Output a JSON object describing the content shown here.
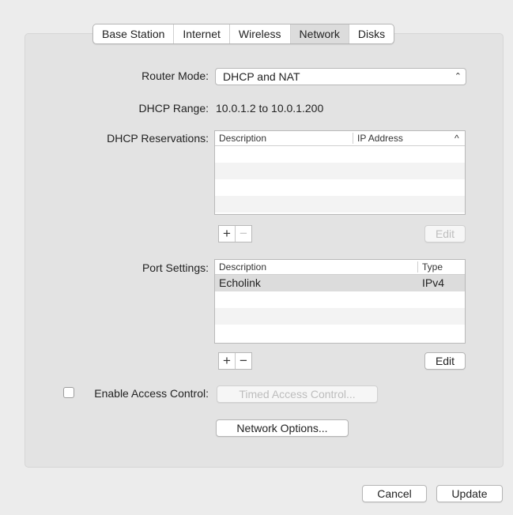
{
  "tabs": [
    {
      "label": "Base Station",
      "active": false
    },
    {
      "label": "Internet",
      "active": false
    },
    {
      "label": "Wireless",
      "active": false
    },
    {
      "label": "Network",
      "active": true
    },
    {
      "label": "Disks",
      "active": false
    }
  ],
  "router_mode": {
    "label": "Router Mode:",
    "value": "DHCP and NAT",
    "icon": "updown-chevrons-icon"
  },
  "dhcp_range": {
    "label": "DHCP Range:",
    "value": "10.0.1.2 to 10.0.1.200"
  },
  "dhcp_reservations": {
    "label": "DHCP Reservations:",
    "columns": [
      "Description",
      "IP Address"
    ],
    "sort_icon": "^",
    "rows": [],
    "add": "+",
    "remove": "−",
    "edit": "Edit"
  },
  "port_settings": {
    "label": "Port Settings:",
    "columns": [
      "Description",
      "Type"
    ],
    "rows": [
      {
        "description": "Echolink",
        "type": "IPv4"
      }
    ],
    "add": "+",
    "remove": "−",
    "edit": "Edit"
  },
  "access_control": {
    "label": "Enable Access Control:",
    "checked": false,
    "timed_button": "Timed Access Control..."
  },
  "network_options_button": "Network Options...",
  "footer": {
    "cancel": "Cancel",
    "update": "Update"
  }
}
